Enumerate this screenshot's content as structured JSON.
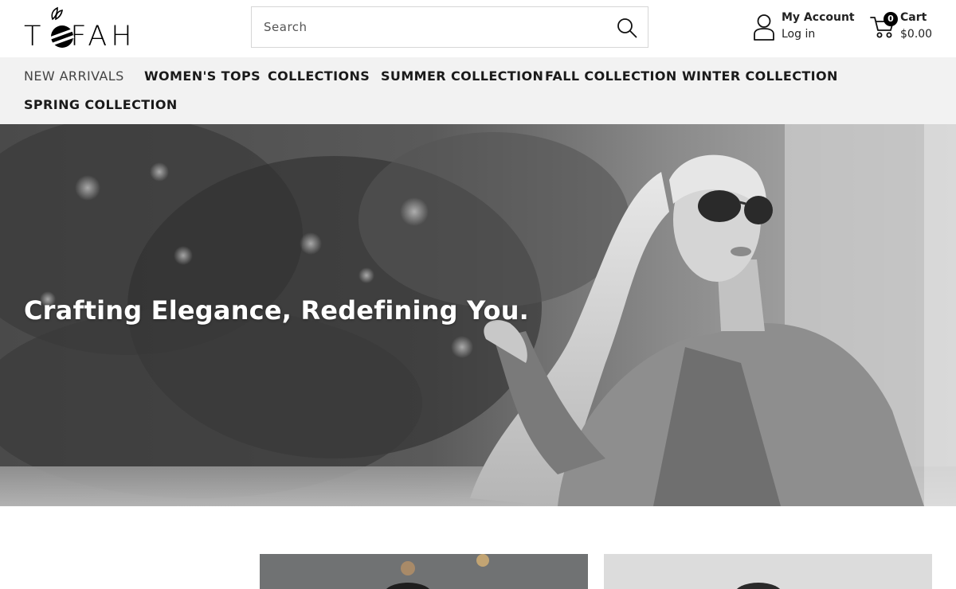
{
  "header": {
    "logo_text": "TOFAH",
    "search": {
      "placeholder": "Search",
      "value": ""
    },
    "account": {
      "title": "My Account",
      "subtitle": "Log in"
    },
    "cart": {
      "title": "Cart",
      "count": "0",
      "total": "$0.00"
    }
  },
  "nav": {
    "items": [
      {
        "label": "NEW ARRIVALS"
      },
      {
        "label": "WOMEN'S TOPS"
      },
      {
        "label": "COLLECTIONS"
      },
      {
        "label": "SUMMER COLLECTION"
      },
      {
        "label": "FALL COLLECTION"
      },
      {
        "label": "WINTER COLLECTION"
      },
      {
        "label": "SPRING COLLECTION"
      }
    ]
  },
  "hero": {
    "headline": "Crafting Elegance, Redefining You."
  },
  "icons": {
    "search": "search-icon",
    "account": "user-icon",
    "cart": "cart-icon"
  },
  "colors": {
    "nav_background": "#f2f2f2",
    "text": "#111111",
    "badge": "#000000"
  }
}
